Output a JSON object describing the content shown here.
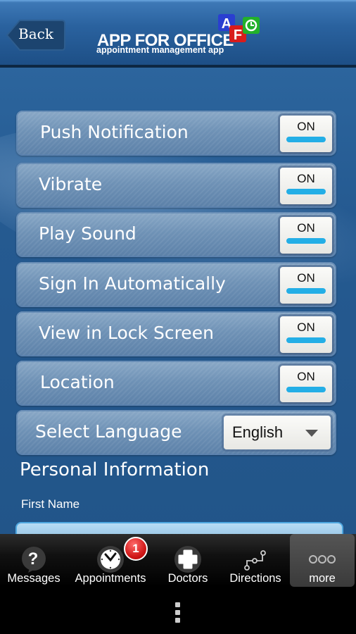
{
  "header": {
    "back_label": "Back",
    "app_title": "APP FOR OFFICE",
    "app_subtitle": "appointment management app",
    "logo_letters": [
      "A",
      "F"
    ]
  },
  "settings": [
    {
      "label": "Push Notification",
      "state": "ON"
    },
    {
      "label": "Vibrate",
      "state": "ON"
    },
    {
      "label": "Play Sound",
      "state": "ON"
    },
    {
      "label": "Sign In Automatically",
      "state": "ON"
    },
    {
      "label": "View in Lock Screen",
      "state": "ON"
    },
    {
      "label": "Location",
      "state": "ON"
    }
  ],
  "language": {
    "label": "Select Language",
    "selected": "English"
  },
  "personal": {
    "section_title": "Personal Information",
    "first_name_label": "First Name",
    "first_name_value": ""
  },
  "tabs": [
    {
      "label": "Messages",
      "icon": "question-bubble-icon"
    },
    {
      "label": "Appointments",
      "icon": "clock-icon",
      "badge": "1"
    },
    {
      "label": "Doctors",
      "icon": "medical-cross-icon"
    },
    {
      "label": "Directions",
      "icon": "route-icon"
    },
    {
      "label": "more",
      "icon": "more-dots-icon"
    }
  ],
  "colors": {
    "accent": "#23aee6",
    "badge": "#d21a1a",
    "background": "#255a91"
  }
}
